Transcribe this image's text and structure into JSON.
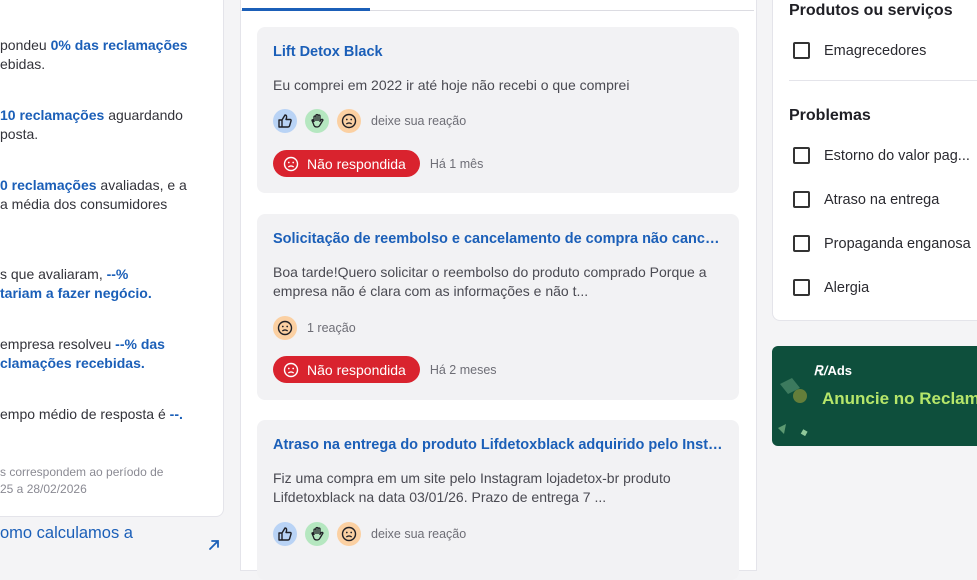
{
  "left_stats": {
    "responded_pre": "pondeu ",
    "responded_bold": "0% das reclamações",
    "responded_post": "ebidas.",
    "awaiting_bold": "10 reclamações",
    "awaiting_post": " aguardando",
    "awaiting_line2": "posta.",
    "evaluated_bold": "0 reclamações",
    "evaluated_post": " avaliadas, e a",
    "evaluated_line2": "a média dos consumidores",
    "would_pre": "s que avaliaram, ",
    "would_bold1": "--%",
    "would_bold2": "tariam a fazer negócio.",
    "solved_pre": "empresa resolveu ",
    "solved_bold": "--% das",
    "solved_bold2": "clamações recebidas.",
    "time_pre": "empo médio de resposta é ",
    "time_bold": "--.",
    "period_line1": "s correspondem ao período de",
    "period_line2": "25 a 28/02/2026",
    "calc_link": "omo calculamos a"
  },
  "complaints": [
    {
      "title": "Lift Detox Black",
      "text": "Eu comprei em 2022 ir até hoje não recebi o que comprei",
      "reaction_label": "deixe sua reação",
      "status": "Não respondida",
      "time": "Há 1 mês"
    },
    {
      "title": "Solicitação de reembolso e cancelamento de compra não cancel...",
      "text": "Boa tarde!Quero solicitar o reembolso do produto comprado Porque a empresa não é clara com as informações e não t...",
      "reaction_label": "1 reação",
      "status": "Não respondida",
      "time": "Há 2 meses"
    },
    {
      "title": "Atraso na entrega do produto Lifdetoxblack adquirido pelo Insta...",
      "text": "Fiz uma compra em um site pelo Instagram lojadetox-br produto Lifdetoxblack na data 03/01/26. Prazo de entrega 7 ...",
      "reaction_label": "deixe sua reação"
    }
  ],
  "filters": {
    "products_heading": "Produtos ou serviços",
    "products": [
      "Emagrecedores"
    ],
    "problems_heading": "Problemas",
    "problems": [
      "Estorno do valor pag...",
      "Atraso na entrega",
      "Propaganda enganosa",
      "Alergia"
    ]
  },
  "ads": {
    "logo": "Ads",
    "title": "Anuncie no Reclam"
  },
  "colors": {
    "link_blue": "#1b5fb8",
    "status_red": "#d9232e",
    "ads_green": "#0e4f3c",
    "ads_lime": "#b6e66a"
  }
}
